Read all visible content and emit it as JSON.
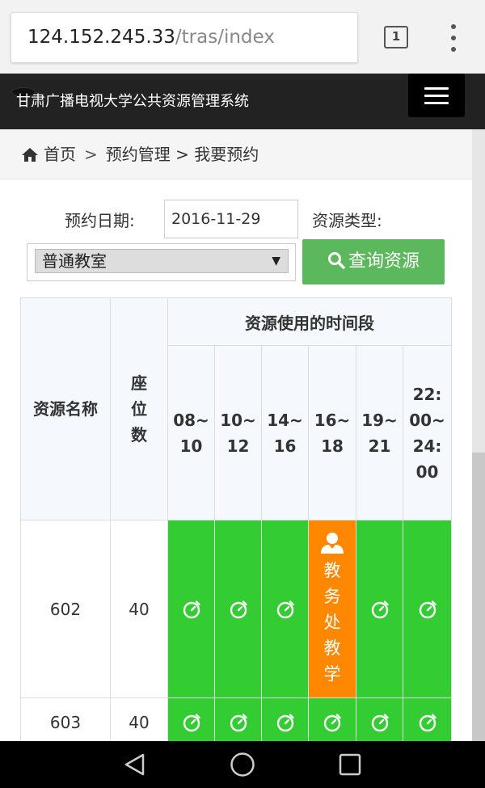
{
  "browser": {
    "url_host": "124.152.245.33",
    "url_path": "/tras/index",
    "tab_count": "1"
  },
  "header": {
    "brand": "甘肃广播电视大学公共资源管理系统"
  },
  "breadcrumb": {
    "home": "首页",
    "sep": ">",
    "level2": "预约管理",
    "level3": "我要预约"
  },
  "form": {
    "date_label": "预约日期:",
    "date_value": "2016-11-29",
    "type_label": "资源类型:",
    "type_value": "普通教室",
    "query_button": "查询资源"
  },
  "table": {
    "col_name": "资源名称",
    "col_seats": "座位数",
    "group_header": "资源使用的时间段",
    "slots": [
      "08~10",
      "10~12",
      "14~16",
      "16~18",
      "19~21",
      "22:00~24:00"
    ],
    "rows": [
      {
        "name": "602",
        "seats": "40",
        "slots": [
          "free",
          "free",
          "free",
          "教务处教学",
          "free",
          "free"
        ]
      },
      {
        "name": "603",
        "seats": "40",
        "slots": [
          "free",
          "free",
          "free",
          "free",
          "free",
          "free"
        ]
      }
    ]
  },
  "colors": {
    "free": "#33cc33",
    "booked": "#ff8800",
    "query_button": "#5cb85c",
    "header_bg": "#222222"
  },
  "icons": {
    "slot_free": "stopwatch-icon",
    "slot_booked": "user-icon",
    "query": "search-icon",
    "home": "home-icon"
  }
}
